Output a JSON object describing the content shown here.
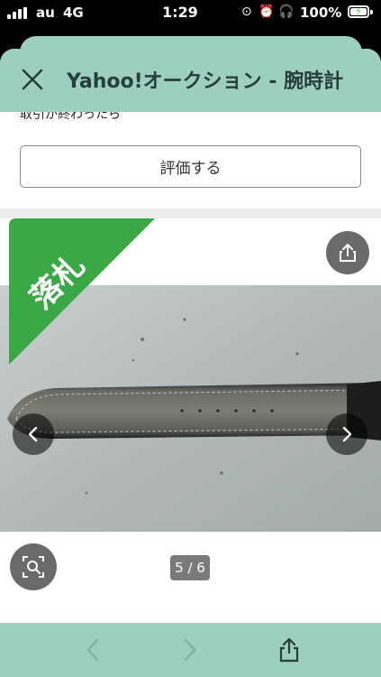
{
  "status_bar": {
    "carrier": "au",
    "network": "4G",
    "time": "1:29",
    "battery": "100%",
    "icons": [
      "signal-icon",
      "rotation-lock-icon",
      "alarm-icon",
      "headphones-icon",
      "battery-charging-icon"
    ]
  },
  "sheet": {
    "title": "Yahoo!オークション - 腕時計",
    "close_icon": "close-icon"
  },
  "page": {
    "clipped_text": "取引が終わったら",
    "rate_button_label": "評価する",
    "sold_badge": "落札",
    "photo_counter": "5 / 6",
    "icons": [
      "share-icon",
      "chevron-left-icon",
      "chevron-right-icon",
      "image-search-icon"
    ]
  },
  "toolbar": {
    "icons": [
      "back-arrow-icon",
      "forward-arrow-icon",
      "share-icon"
    ]
  },
  "colors": {
    "header_bg": "#9ccfbd",
    "sold_badge": "#3aa845",
    "title_text": "#263e3c"
  }
}
